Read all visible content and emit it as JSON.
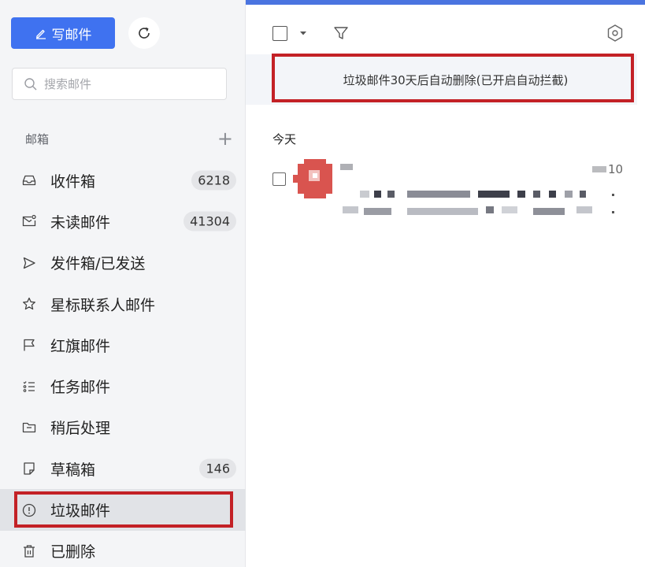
{
  "colors": {
    "accent": "#3f72f0",
    "highlight_box": "#c32126",
    "sidebar_bg": "#f4f5f7",
    "avatar": "#d9544f"
  },
  "toolbar": {
    "compose_label": "写邮件",
    "compose_icon": "pen-icon",
    "refresh_icon": "refresh-icon"
  },
  "search": {
    "placeholder": "搜索邮件",
    "value": ""
  },
  "sidebar": {
    "section_title": "邮箱",
    "add_label": "+",
    "items": [
      {
        "label": "收件箱",
        "icon": "inbox-icon",
        "badge": "6218"
      },
      {
        "label": "未读邮件",
        "icon": "unread-mail-icon",
        "badge": "41304"
      },
      {
        "label": "发件箱/已发送",
        "icon": "send-icon",
        "badge": ""
      },
      {
        "label": "星标联系人邮件",
        "icon": "star-icon",
        "badge": ""
      },
      {
        "label": "红旗邮件",
        "icon": "flag-icon",
        "badge": ""
      },
      {
        "label": "任务邮件",
        "icon": "task-list-icon",
        "badge": ""
      },
      {
        "label": "稍后处理",
        "icon": "folder-icon",
        "badge": ""
      },
      {
        "label": "草稿箱",
        "icon": "draft-icon",
        "badge": "146"
      },
      {
        "label": "垃圾邮件",
        "icon": "spam-icon",
        "badge": "",
        "active": true
      },
      {
        "label": "已删除",
        "icon": "trash-icon",
        "badge": ""
      }
    ]
  },
  "main": {
    "notice": "垃圾邮件30天后自动删除(已开启自动拦截)",
    "group_label": "今天",
    "mail": {
      "date_suffix": "10"
    }
  }
}
